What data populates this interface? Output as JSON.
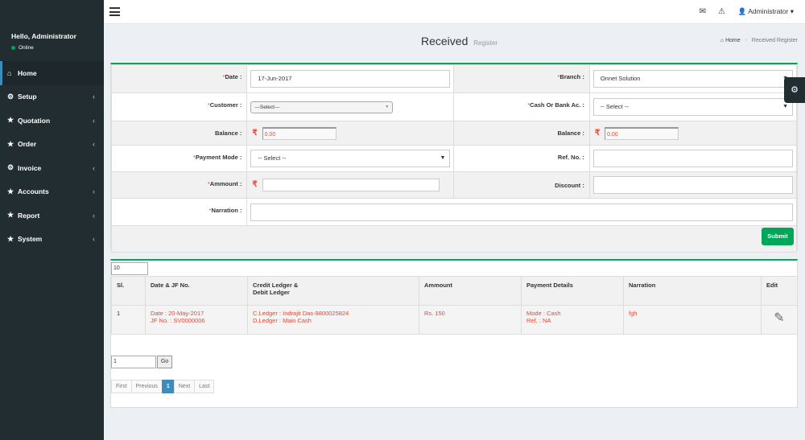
{
  "sidebar": {
    "greeting": "Hello, Administrator",
    "status": "Online",
    "items": [
      {
        "label": "Home",
        "icon": "home-icon"
      },
      {
        "label": "Setup",
        "icon": "cogs-icon"
      },
      {
        "label": "Quotation",
        "icon": "star-icon"
      },
      {
        "label": "Order",
        "icon": "star-icon"
      },
      {
        "label": "Invoice",
        "icon": "cogs-icon"
      },
      {
        "label": "Accounts",
        "icon": "star-icon"
      },
      {
        "label": "Report",
        "icon": "star-icon"
      },
      {
        "label": "System",
        "icon": "star-icon"
      }
    ]
  },
  "topbar": {
    "user": "Administrator"
  },
  "header": {
    "title": "Received",
    "subtitle": "Register",
    "breadcrumb_home": "Home",
    "breadcrumb_current": "Received Register"
  },
  "form": {
    "date_label": "Date :",
    "date_value": "17-Jun-2017",
    "branch_label": "Branch :",
    "branch_value": "Onnet Solution",
    "customer_label": "Customer :",
    "customer_value": "---Select---",
    "cash_bank_label": "Cash Or Bank Ac. :",
    "cash_bank_value": "-- Select --",
    "balance_label": "Balance :",
    "balance_left_value": "0.00",
    "balance_right_value": "0.00",
    "payment_mode_label": "Payment Mode :",
    "payment_mode_value": "-- Select --",
    "ref_no_label": "Ref. No. :",
    "amount_label": "Ammount :",
    "discount_label": "Discount :",
    "narration_label": "Narration :",
    "required_mark": "*",
    "submit_label": "Submit"
  },
  "list": {
    "per_page": "10",
    "columns": [
      "Sl.",
      "Date & JF No.",
      "Credit Ledger &",
      "Debit Ledger",
      "Ammount",
      "Payment Details",
      "Narration",
      "Edit"
    ],
    "rows": [
      {
        "sl": "1",
        "date_key": "Date :",
        "date_val": "20-May-2017",
        "jf_key": "JF No. :",
        "jf_val": "SV0000006",
        "credit_key": "C.Ledger :",
        "credit_val": "Indrajit Das-9800025824",
        "debit_key": "D.Ledger :",
        "debit_val": "Main Cash",
        "amount": "Rs. 150",
        "mode_key": "Mode :",
        "mode_val": "Cash",
        "ref_key": "Ref. :",
        "ref_val": "NA",
        "narration": "fgh"
      }
    ],
    "goto_value": "1",
    "go_label": "Go",
    "pager": {
      "first": "First",
      "previous": "Previous",
      "current": "1",
      "next": "Next",
      "last": "Last"
    }
  },
  "colors": {
    "sidebar_bg": "#222d32",
    "accent_green": "#00a65a",
    "accent_blue": "#3c8dbc",
    "required_red": "#dd4b39"
  },
  "currency_symbol": "₹"
}
